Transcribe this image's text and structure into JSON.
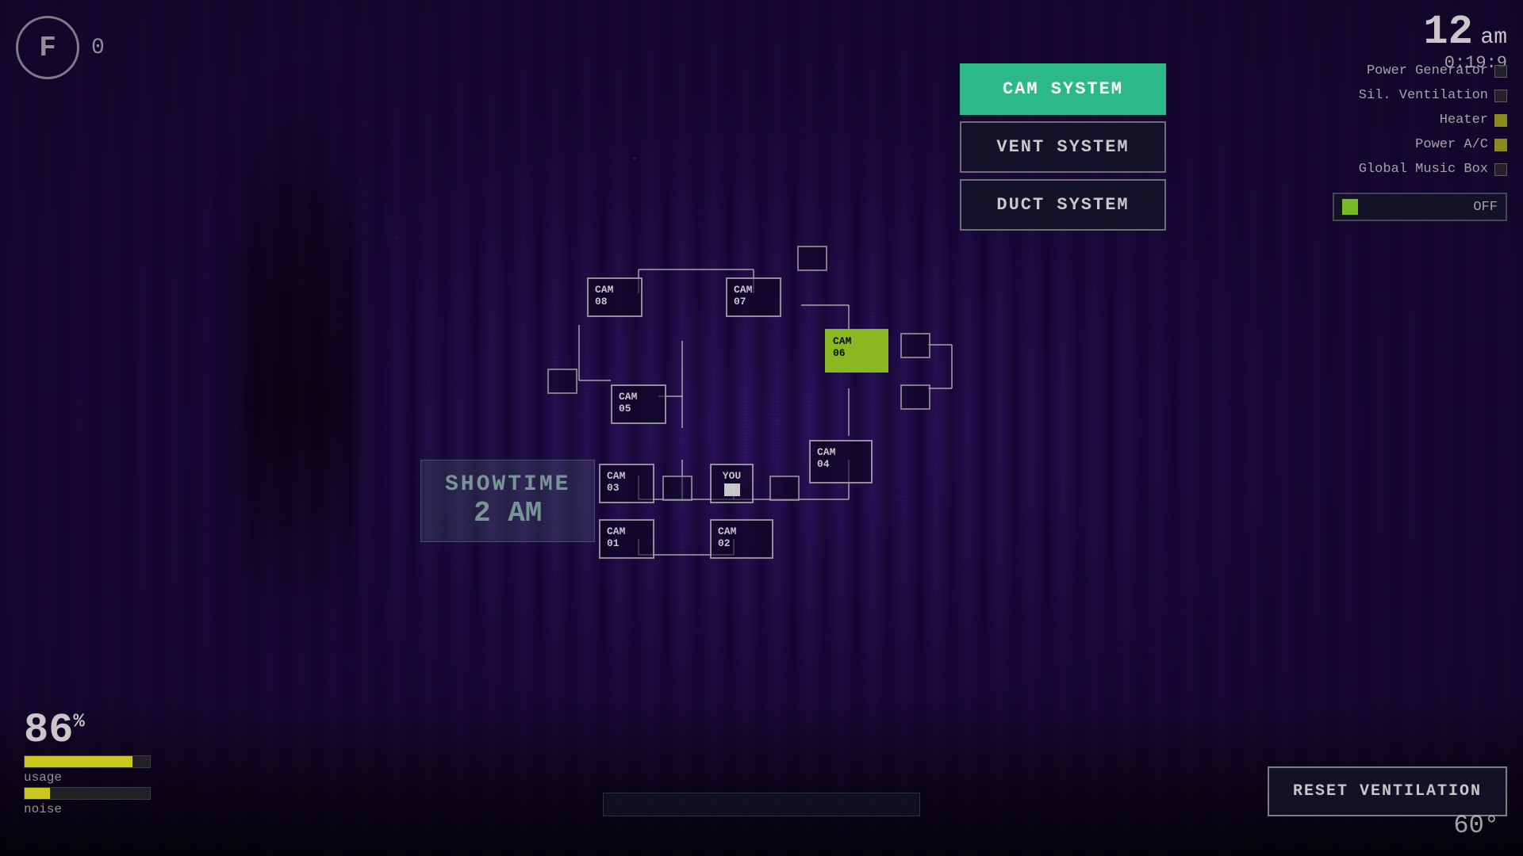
{
  "background": {
    "base_color": "#1a0a2e"
  },
  "header": {
    "icon_letter": "F",
    "score": "0",
    "time_hour": "12",
    "time_suffix": "am",
    "time_countdown": "0:19:9"
  },
  "systems": {
    "cam_system_label": "CAM SYSTEM",
    "vent_system_label": "VENT SYSTEM",
    "duct_system_label": "DUCT SYSTEM"
  },
  "right_panel": {
    "items": [
      {
        "label": "Power Generator",
        "state": "off"
      },
      {
        "label": "Sil. Ventilation",
        "state": "off"
      },
      {
        "label": "Heater",
        "state": "dim"
      },
      {
        "label": "Power A/C",
        "state": "dim"
      },
      {
        "label": "Global Music Box",
        "state": "off"
      }
    ],
    "off_label": "OFF"
  },
  "showtime": {
    "title": "SHOWTIME",
    "time": "2 AM"
  },
  "cameras": [
    {
      "id": "cam01",
      "label": "CAM\n01",
      "active": false
    },
    {
      "id": "cam02",
      "label": "CAM\n02",
      "active": false
    },
    {
      "id": "cam03",
      "label": "CAM\n03",
      "active": false
    },
    {
      "id": "cam04",
      "label": "CAM\n04",
      "active": false
    },
    {
      "id": "cam05",
      "label": "CAM\n05",
      "active": false
    },
    {
      "id": "cam06",
      "label": "CAM\n06",
      "active": true
    },
    {
      "id": "cam07",
      "label": "CAM\n07",
      "active": false
    },
    {
      "id": "cam08",
      "label": "CAM\n08",
      "active": false
    }
  ],
  "you_label": "YOU",
  "stats": {
    "usage_percent": "86",
    "usage_symbol": "%",
    "usage_label": "usage",
    "usage_bar_width": "86",
    "noise_label": "noise",
    "noise_bar_width": "20"
  },
  "buttons": {
    "reset_ventilation": "RESET VENTILATION"
  },
  "degree": {
    "value": "60",
    "symbol": "°"
  }
}
